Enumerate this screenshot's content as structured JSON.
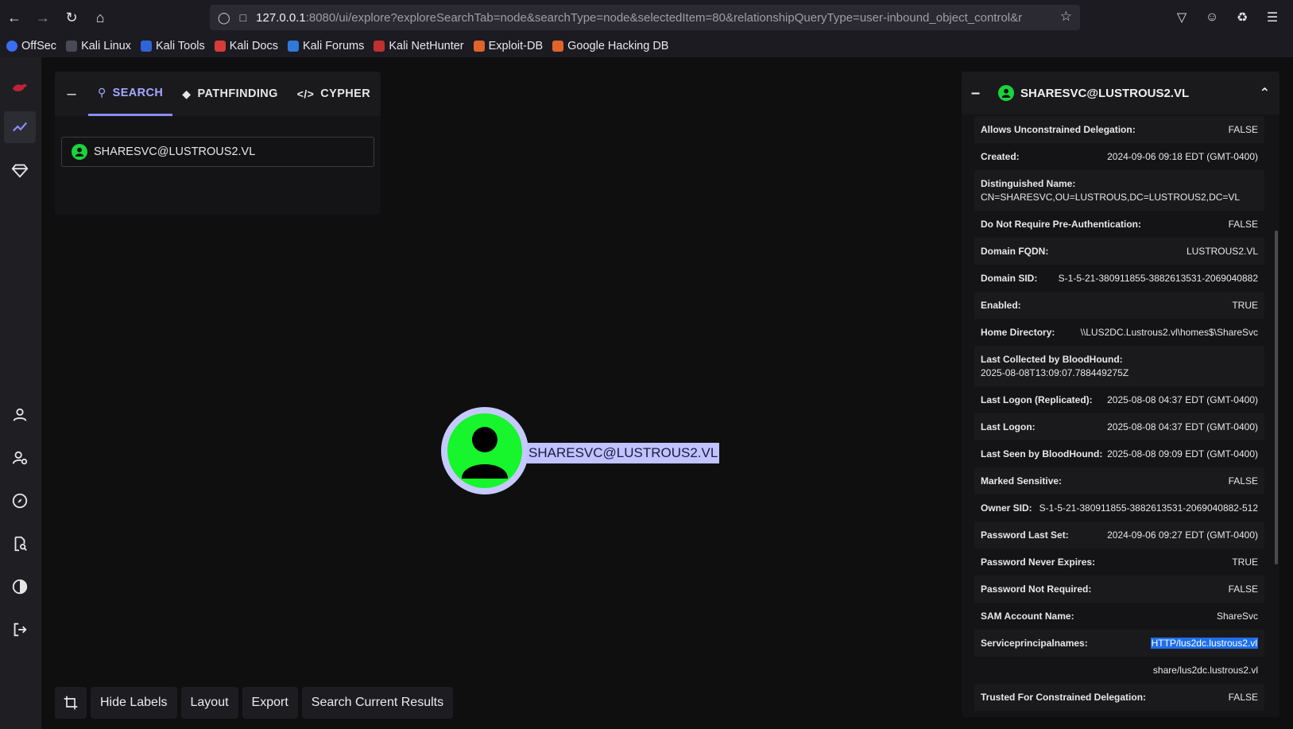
{
  "browser": {
    "url_host": "127.0.0.1",
    "url_rest": ":8080/ui/explore?exploreSearchTab=node&searchType=node&selectedItem=80&relationshipQueryType=user-inbound_object_control&r",
    "bookmarks": [
      "OffSec",
      "Kali Linux",
      "Kali Tools",
      "Kali Docs",
      "Kali Forums",
      "Kali NetHunter",
      "Exploit-DB",
      "Google Hacking DB"
    ]
  },
  "search": {
    "tabs": {
      "search": "SEARCH",
      "pathfinding": "PATHFINDING",
      "cypher": "CYPHER"
    },
    "value": "SHARESVC@LUSTROUS2.VL"
  },
  "graph": {
    "node_label": "SHARESVC@LUSTROUS2.VL"
  },
  "toolbar": {
    "hide_labels": "Hide Labels",
    "layout": "Layout",
    "export": "Export",
    "search_results": "Search Current Results"
  },
  "detail": {
    "title": "SHARESVC@LUSTROUS2.VL",
    "props": [
      {
        "k": "Allows Unconstrained Delegation:",
        "v": "FALSE"
      },
      {
        "k": "Created:",
        "v": "2024-09-06 09:18 EDT (GMT-0400)"
      },
      {
        "k": "Distinguished Name:",
        "v": "CN=SHARESVC,OU=LUSTROUS,DC=LUSTROUS2,DC=VL"
      },
      {
        "k": "Do Not Require Pre-Authentication:",
        "v": "FALSE"
      },
      {
        "k": "Domain FQDN:",
        "v": "LUSTROUS2.VL"
      },
      {
        "k": "Domain SID:",
        "v": "S-1-5-21-380911855-3882613531-2069040882"
      },
      {
        "k": "Enabled:",
        "v": "TRUE"
      },
      {
        "k": "Home Directory:",
        "v": "\\\\LUS2DC.Lustrous2.vl\\homes$\\ShareSvc"
      },
      {
        "k": "Last Collected by BloodHound:",
        "v": "2025-08-08T13:09:07.788449275Z"
      },
      {
        "k": "Last Logon (Replicated):",
        "v": "2025-08-08 04:37 EDT (GMT-0400)"
      },
      {
        "k": "Last Logon:",
        "v": "2025-08-08 04:37 EDT (GMT-0400)"
      },
      {
        "k": "Last Seen by BloodHound:",
        "v": "2025-08-08 09:09 EDT (GMT-0400)"
      },
      {
        "k": "Marked Sensitive:",
        "v": "FALSE"
      },
      {
        "k": "Owner SID:",
        "v": "S-1-5-21-380911855-3882613531-2069040882-512"
      },
      {
        "k": "Password Last Set:",
        "v": "2024-09-06 09:27 EDT (GMT-0400)"
      },
      {
        "k": "Password Never Expires:",
        "v": "TRUE"
      },
      {
        "k": "Password Not Required:",
        "v": "FALSE"
      },
      {
        "k": "SAM Account Name:",
        "v": "ShareSvc"
      },
      {
        "k": "Serviceprincipalnames:",
        "v": "HTTP/lus2dc.lustrous2.vl"
      },
      {
        "k": "",
        "v": "share/lus2dc.lustrous2.vl"
      },
      {
        "k": "Trusted For Constrained Delegation:",
        "v": "FALSE"
      }
    ]
  }
}
